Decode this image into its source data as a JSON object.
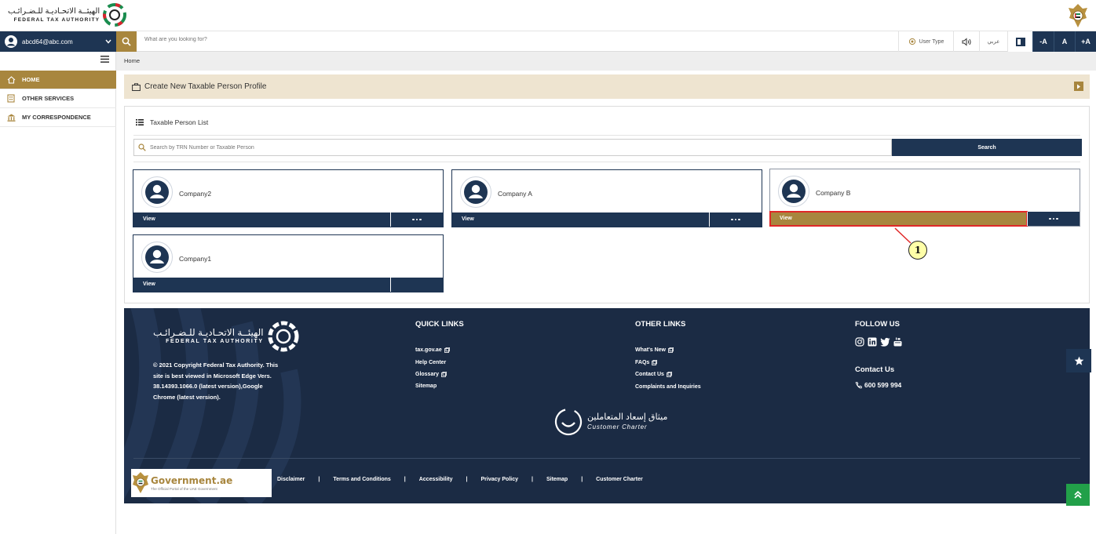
{
  "header": {
    "logo_ar": "الهيئــة الاتحـاديـة للـضـرائـب",
    "logo_en": "FEDERAL TAX AUTHORITY"
  },
  "nav": {
    "user_email": "abcd64@abc.com",
    "search_placeholder": "What are you looking for?",
    "user_type": "User Type",
    "lang": "عربي",
    "font_decrease": "-A",
    "font_reset": "A",
    "font_increase": "+A"
  },
  "sidebar": {
    "items": [
      {
        "label": "HOME",
        "icon": "home-icon"
      },
      {
        "label": "OTHER SERVICES",
        "icon": "building-icon"
      },
      {
        "label": "MY CORRESPONDENCE",
        "icon": "bank-icon"
      }
    ]
  },
  "breadcrumb": {
    "current": "Home"
  },
  "banner": {
    "label": "Create New Taxable Person Profile"
  },
  "panel": {
    "title": "Taxable Person List",
    "search_placeholder": "Search by TRN Number or Taxable Person",
    "search_label": "Search"
  },
  "cards": [
    {
      "name": "Company2",
      "view": "View"
    },
    {
      "name": "Company A",
      "view": "View"
    },
    {
      "name": "Company B",
      "view": "View"
    },
    {
      "name": "Company1",
      "view": "View"
    }
  ],
  "callout": {
    "number": "1"
  },
  "footer": {
    "logo_ar": "الهيئــة الاتحـاديـة للـضـرائـب",
    "logo_en": "FEDERAL TAX AUTHORITY",
    "copyright": "© 2021 Copyright Federal Tax Authority. This site is best viewed in Microsoft Edge Vers. 38.14393.1066.0 (latest version),Google Chrome (latest version).",
    "quick_links_title": "QUICK LINKS",
    "quick_links": [
      "tax.gov.ae",
      "Help Center",
      "Glossary",
      "Sitemap"
    ],
    "other_links_title": "OTHER LINKS",
    "other_links": [
      "What's New",
      "FAQs",
      "Contact Us",
      "Complaints and Inquiries"
    ],
    "follow_title": "FOLLOW US",
    "contact_title": "Contact Us",
    "phone": "600 599 994",
    "charter_ar": "ميثاق إسعاد المتعاملين",
    "charter_en": "Customer Charter",
    "gov_title": "Government.ae",
    "gov_sub": "The Official Portal of the UAE Government",
    "bottom_links": [
      "Disclaimer",
      "Terms and Conditions",
      "Accessibility",
      "Privacy Policy",
      "Sitemap",
      "Customer Charter"
    ]
  },
  "colors": {
    "navy": "#1e3553",
    "gold": "#a8863e",
    "footer_bg": "#1b2b44",
    "highlight": "#e02727",
    "scroll_top": "#22a049"
  }
}
